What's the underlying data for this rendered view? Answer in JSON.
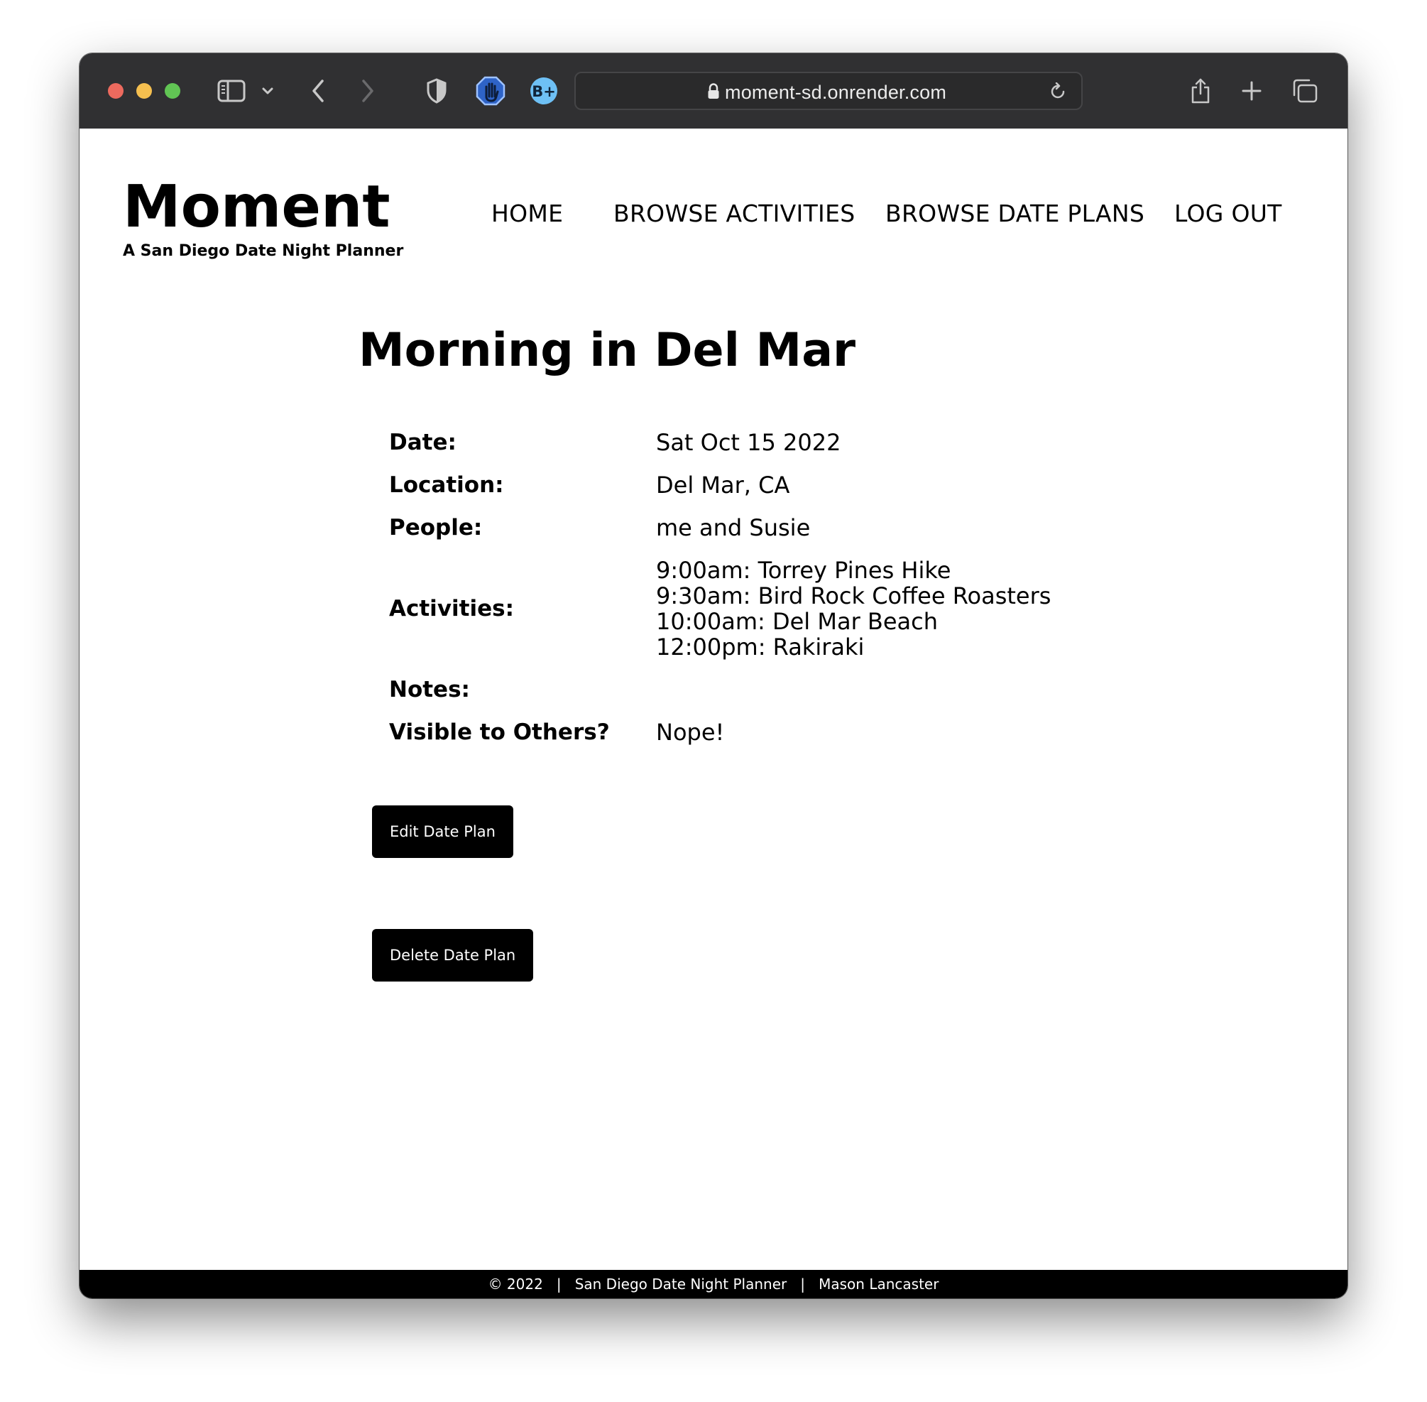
{
  "browser": {
    "url": "moment-sd.onrender.com"
  },
  "site": {
    "title": "Moment",
    "subtitle": "A San Diego Date Night Planner",
    "nav": {
      "home": "HOME",
      "browse_activities": "BROWSE ACTIVITIES",
      "browse_date_plans": "BROWSE DATE PLANS",
      "log_out": "LOG OUT"
    }
  },
  "plan": {
    "title": "Morning in Del Mar",
    "details": {
      "date_label": "Date:",
      "date_value": "Sat Oct 15 2022",
      "location_label": "Location:",
      "location_value": "Del Mar, CA",
      "people_label": "People:",
      "people_value": "me and Susie",
      "activities_label": "Activities:",
      "activities": [
        "9:00am: Torrey Pines Hike",
        "9:30am: Bird Rock Coffee Roasters",
        "10:00am: Del Mar Beach",
        "12:00pm: Rakiraki"
      ],
      "notes_label": "Notes:",
      "notes_value": "",
      "visible_label": "Visible to Others?",
      "visible_value": "Nope!"
    },
    "edit_button": "Edit Date Plan",
    "delete_button": "Delete Date Plan"
  },
  "footer": {
    "text": "© 2022   |   San Diego Date Night Planner   |   Mason Lancaster"
  }
}
